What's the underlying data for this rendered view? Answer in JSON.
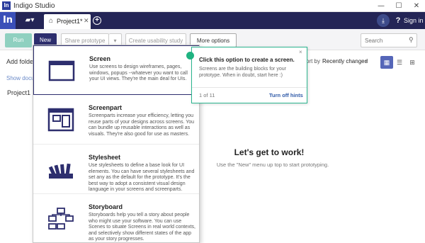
{
  "app": {
    "title": "Indigo Studio",
    "logo_text": "In"
  },
  "window": {
    "minimize": "—",
    "maximize": "☐",
    "close": "✕"
  },
  "navbar": {
    "tab_label": "Project1*",
    "signin": "Sign in",
    "help": "?"
  },
  "toolbar": {
    "run": "Run",
    "new": "New",
    "share": "Share prototype",
    "share_dd": "▾",
    "usability": "Create usability study",
    "more": "More options",
    "search_placeholder": "Search"
  },
  "left": {
    "add_folder": "Add folder",
    "show_docu": "Show docu",
    "project": "Project1"
  },
  "sort": {
    "label": "ort by",
    "value": "Recently changed"
  },
  "empty": {
    "title": "Let's get to work!",
    "subtitle": "Use the \"New\" menu up top to start prototyping."
  },
  "menu": {
    "items": [
      {
        "title": "Screen",
        "desc": "Use screens to design wireframes, pages, windows, popups --whatever you want to call your UI views. They're the main deal for UIs."
      },
      {
        "title": "Screenpart",
        "desc": "Screenparts increase your efficiency, letting you reuse parts of your designs across screens. You can bundle up reusable interactions as well as visuals. They're also good for use as masters."
      },
      {
        "title": "Stylesheet",
        "desc": "Use stylesheets to define a base look for UI elements. You can have several stylesheets and set any as the default for the prototype. It's the best way to adopt a consistent visual design language in your screens and screenparts."
      },
      {
        "title": "Storyboard",
        "desc": "Storyboards help you tell a story about people who might use your software. You can use Scenes to situate Screens in real world contexts, and selectively show different states of the app as your story progresses."
      }
    ]
  },
  "tooltip": {
    "title": "Click this option to create a screen.",
    "body": "Screens are the building blocks for your prototype. When in doubt, start here :)",
    "count": "1 of 11",
    "turn_off": "Turn off hints",
    "close": "×"
  },
  "colors": {
    "navy": "#242556",
    "accent": "#2d2e6e",
    "teal": "#1fb381",
    "run": "#8fd0c0"
  }
}
